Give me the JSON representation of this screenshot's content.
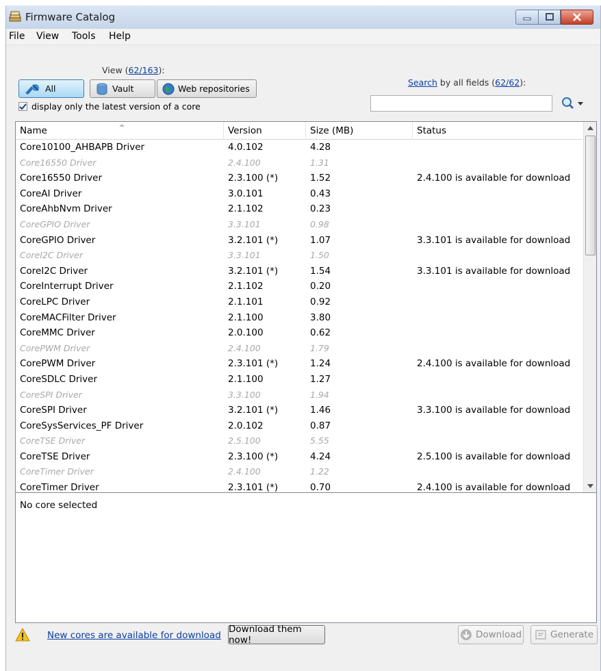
{
  "window": {
    "title": "Firmware Catalog"
  },
  "menu": [
    "File",
    "View",
    "Tools",
    "Help"
  ],
  "view": {
    "prefix": "View (",
    "count": "62/163",
    "suffix": "):"
  },
  "filters": {
    "all": "All",
    "vault": "Vault",
    "web": "Web repositories",
    "active": "All"
  },
  "latest_only": {
    "label": "display only the latest version of a core",
    "checked": true
  },
  "search": {
    "link": "Search",
    "text": " by all fields (",
    "count": "62/62",
    "suffix": "):",
    "value": ""
  },
  "table": {
    "headers": [
      "Name",
      "Version",
      "Size (MB)",
      "Status"
    ],
    "rows": [
      {
        "name": "Core10100_AHBAPB Driver",
        "version": "4.0.102",
        "size": "4.28",
        "status": "",
        "old": false
      },
      {
        "name": "Core16550 Driver",
        "version": "2.4.100",
        "size": "1.31",
        "status": "",
        "old": true
      },
      {
        "name": "Core16550 Driver",
        "version": "2.3.100 (*)",
        "size": "1.52",
        "status": "2.4.100 is available for download",
        "old": false
      },
      {
        "name": "CoreAI Driver",
        "version": "3.0.101",
        "size": "0.43",
        "status": "",
        "old": false
      },
      {
        "name": "CoreAhbNvm Driver",
        "version": "2.1.102",
        "size": "0.23",
        "status": "",
        "old": false
      },
      {
        "name": "CoreGPIO Driver",
        "version": "3.3.101",
        "size": "0.98",
        "status": "",
        "old": true
      },
      {
        "name": "CoreGPIO Driver",
        "version": "3.2.101 (*)",
        "size": "1.07",
        "status": "3.3.101 is available for download",
        "old": false
      },
      {
        "name": "CoreI2C Driver",
        "version": "3.3.101",
        "size": "1.50",
        "status": "",
        "old": true
      },
      {
        "name": "CoreI2C Driver",
        "version": "3.2.101 (*)",
        "size": "1.54",
        "status": "3.3.101 is available for download",
        "old": false
      },
      {
        "name": "CoreInterrupt Driver",
        "version": "2.1.102",
        "size": "0.20",
        "status": "",
        "old": false
      },
      {
        "name": "CoreLPC Driver",
        "version": "2.1.101",
        "size": "0.92",
        "status": "",
        "old": false
      },
      {
        "name": "CoreMACFilter Driver",
        "version": "2.1.100",
        "size": "3.80",
        "status": "",
        "old": false
      },
      {
        "name": "CoreMMC Driver",
        "version": "2.0.100",
        "size": "0.62",
        "status": "",
        "old": false
      },
      {
        "name": "CorePWM Driver",
        "version": "2.4.100",
        "size": "1.79",
        "status": "",
        "old": true
      },
      {
        "name": "CorePWM Driver",
        "version": "2.3.101 (*)",
        "size": "1.24",
        "status": "2.4.100 is available for download",
        "old": false
      },
      {
        "name": "CoreSDLC Driver",
        "version": "2.1.100",
        "size": "1.27",
        "status": "",
        "old": false
      },
      {
        "name": "CoreSPI Driver",
        "version": "3.3.100",
        "size": "1.94",
        "status": "",
        "old": true
      },
      {
        "name": "CoreSPI Driver",
        "version": "3.2.101 (*)",
        "size": "1.46",
        "status": "3.3.100 is available for download",
        "old": false
      },
      {
        "name": "CoreSysServices_PF Driver",
        "version": "2.0.102",
        "size": "0.87",
        "status": "",
        "old": false
      },
      {
        "name": "CoreTSE Driver",
        "version": "2.5.100",
        "size": "5.55",
        "status": "",
        "old": true
      },
      {
        "name": "CoreTSE Driver",
        "version": "2.3.100 (*)",
        "size": "4.24",
        "status": "2.5.100 is available for download",
        "old": false
      },
      {
        "name": "CoreTimer Driver",
        "version": "2.4.100",
        "size": "1.22",
        "status": "",
        "old": true
      },
      {
        "name": "CoreTimer Driver",
        "version": "2.3.101 (*)",
        "size": "0.70",
        "status": "2.4.100 is available for download",
        "old": false
      }
    ]
  },
  "details": {
    "text": "No core selected"
  },
  "bottom": {
    "link": "New cores are available for download",
    "download_now": "Download them now!",
    "download": "Download",
    "generate": "Generate"
  },
  "colors": {
    "link": "#0a3fa3",
    "muted": "#a8a8a8",
    "accent": "#3c7fb1"
  }
}
